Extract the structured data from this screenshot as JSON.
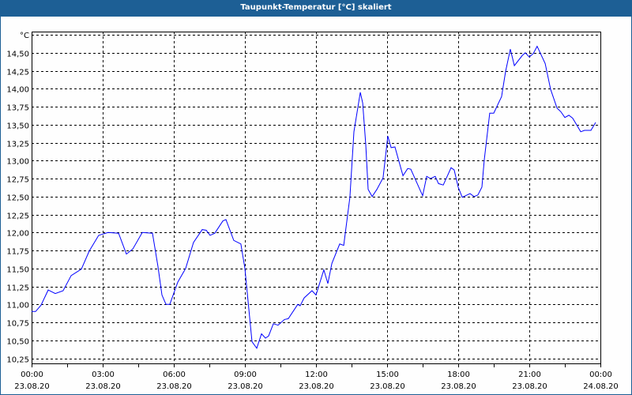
{
  "window": {
    "title": "Taupunkt-Temperatur [°C] skaliert"
  },
  "colors": {
    "line": "#0000ff",
    "titlebar": "#1d5f95",
    "grid": "#000000"
  },
  "chart_data": {
    "type": "line",
    "title": "Taupunkt-Temperatur [°C] skaliert",
    "ylabel": "°C",
    "xlabel": "",
    "ylim": [
      10.19,
      14.75
    ],
    "xlim_hours": [
      0,
      24
    ],
    "grid": true,
    "y_ticks": [
      {
        "value": 14.5,
        "label": "14,50"
      },
      {
        "value": 14.25,
        "label": "14,25"
      },
      {
        "value": 14.0,
        "label": "14,00"
      },
      {
        "value": 13.75,
        "label": "13,75"
      },
      {
        "value": 13.5,
        "label": "13,50"
      },
      {
        "value": 13.25,
        "label": "13,25"
      },
      {
        "value": 13.0,
        "label": "13,00"
      },
      {
        "value": 12.75,
        "label": "12,75"
      },
      {
        "value": 12.5,
        "label": "12,50"
      },
      {
        "value": 12.25,
        "label": "12,25"
      },
      {
        "value": 12.0,
        "label": "12,00"
      },
      {
        "value": 11.75,
        "label": "11,75"
      },
      {
        "value": 11.5,
        "label": "11,50"
      },
      {
        "value": 11.25,
        "label": "11,25"
      },
      {
        "value": 11.0,
        "label": "11,00"
      },
      {
        "value": 10.75,
        "label": "10,75"
      },
      {
        "value": 10.5,
        "label": "10,50"
      },
      {
        "value": 10.25,
        "label": "10,25"
      }
    ],
    "x_ticks": [
      {
        "hour": 0,
        "time": "00:00",
        "date": "23.08.20"
      },
      {
        "hour": 3,
        "time": "03:00",
        "date": "23.08.20"
      },
      {
        "hour": 6,
        "time": "06:00",
        "date": "23.08.20"
      },
      {
        "hour": 9,
        "time": "09:00",
        "date": "23.08.20"
      },
      {
        "hour": 12,
        "time": "12:00",
        "date": "23.08.20"
      },
      {
        "hour": 15,
        "time": "15:00",
        "date": "23.08.20"
      },
      {
        "hour": 18,
        "time": "18:00",
        "date": "23.08.20"
      },
      {
        "hour": 21,
        "time": "21:00",
        "date": "23.08.20"
      },
      {
        "hour": 24,
        "time": "00:00",
        "date": "24.08.20"
      }
    ],
    "series": [
      {
        "name": "Taupunkt-Temperatur",
        "points": [
          [
            0,
            10.9
          ],
          [
            0.17,
            10.9
          ],
          [
            0.4,
            10.99
          ],
          [
            0.7,
            11.2
          ],
          [
            1.0,
            11.15
          ],
          [
            1.33,
            11.19
          ],
          [
            1.67,
            11.4
          ],
          [
            2.1,
            11.49
          ],
          [
            2.43,
            11.74
          ],
          [
            2.83,
            11.96
          ],
          [
            3.23,
            12.0
          ],
          [
            3.67,
            11.99
          ],
          [
            4.0,
            11.7
          ],
          [
            4.27,
            11.77
          ],
          [
            4.67,
            12.0
          ],
          [
            5.1,
            11.99
          ],
          [
            5.33,
            11.53
          ],
          [
            5.5,
            11.13
          ],
          [
            5.67,
            11.0
          ],
          [
            5.83,
            11.0
          ],
          [
            6.17,
            11.31
          ],
          [
            6.5,
            11.5
          ],
          [
            6.83,
            11.86
          ],
          [
            7.2,
            12.04
          ],
          [
            7.37,
            12.03
          ],
          [
            7.53,
            11.96
          ],
          [
            7.73,
            11.99
          ],
          [
            8.07,
            12.16
          ],
          [
            8.2,
            12.18
          ],
          [
            8.53,
            11.89
          ],
          [
            8.83,
            11.84
          ],
          [
            9.0,
            11.5
          ],
          [
            9.3,
            10.48
          ],
          [
            9.5,
            10.39
          ],
          [
            9.7,
            10.59
          ],
          [
            9.87,
            10.53
          ],
          [
            10.0,
            10.56
          ],
          [
            10.2,
            10.73
          ],
          [
            10.4,
            10.71
          ],
          [
            10.67,
            10.79
          ],
          [
            10.83,
            10.8
          ],
          [
            11.23,
            11.0
          ],
          [
            11.33,
            10.98
          ],
          [
            11.5,
            11.09
          ],
          [
            11.83,
            11.19
          ],
          [
            12.0,
            11.13
          ],
          [
            12.33,
            11.48
          ],
          [
            12.5,
            11.29
          ],
          [
            12.67,
            11.57
          ],
          [
            13.0,
            11.84
          ],
          [
            13.17,
            11.82
          ],
          [
            13.43,
            12.49
          ],
          [
            13.6,
            13.4
          ],
          [
            13.87,
            13.95
          ],
          [
            13.97,
            13.8
          ],
          [
            14.1,
            13.22
          ],
          [
            14.2,
            12.6
          ],
          [
            14.37,
            12.5
          ],
          [
            14.57,
            12.6
          ],
          [
            14.83,
            12.76
          ],
          [
            15.03,
            13.34
          ],
          [
            15.17,
            13.18
          ],
          [
            15.33,
            13.19
          ],
          [
            15.67,
            12.79
          ],
          [
            15.87,
            12.89
          ],
          [
            16.0,
            12.88
          ],
          [
            16.5,
            12.51
          ],
          [
            16.67,
            12.78
          ],
          [
            16.83,
            12.75
          ],
          [
            17.03,
            12.78
          ],
          [
            17.17,
            12.68
          ],
          [
            17.37,
            12.66
          ],
          [
            17.7,
            12.9
          ],
          [
            17.83,
            12.87
          ],
          [
            18.0,
            12.63
          ],
          [
            18.17,
            12.49
          ],
          [
            18.5,
            12.54
          ],
          [
            18.67,
            12.5
          ],
          [
            18.83,
            12.52
          ],
          [
            19.0,
            12.63
          ],
          [
            19.1,
            13.01
          ],
          [
            19.33,
            13.66
          ],
          [
            19.5,
            13.66
          ],
          [
            19.83,
            13.89
          ],
          [
            20.0,
            14.24
          ],
          [
            20.2,
            14.55
          ],
          [
            20.37,
            14.32
          ],
          [
            20.7,
            14.46
          ],
          [
            20.83,
            14.5
          ],
          [
            21.0,
            14.44
          ],
          [
            21.17,
            14.49
          ],
          [
            21.33,
            14.59
          ],
          [
            21.67,
            14.35
          ],
          [
            21.9,
            13.99
          ],
          [
            22.17,
            13.73
          ],
          [
            22.33,
            13.68
          ],
          [
            22.5,
            13.6
          ],
          [
            22.67,
            13.63
          ],
          [
            22.83,
            13.59
          ],
          [
            23.17,
            13.4
          ],
          [
            23.33,
            13.42
          ],
          [
            23.6,
            13.42
          ],
          [
            23.8,
            13.53
          ]
        ]
      }
    ]
  }
}
